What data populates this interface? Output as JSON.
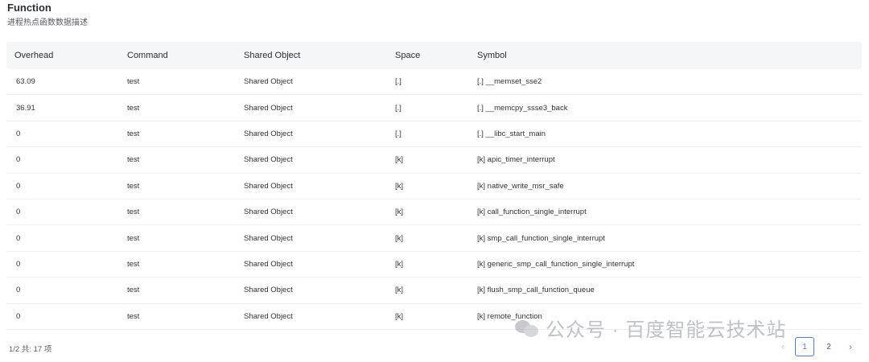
{
  "header": {
    "title": "Function",
    "subtitle": "进程热点函数数据描述"
  },
  "table": {
    "columns": [
      "Overhead",
      "Command",
      "Shared Object",
      "Space",
      "Symbol"
    ],
    "rows": [
      {
        "overhead": "63.09",
        "command": "test",
        "shared_object": "Shared Object",
        "space": "[.]",
        "symbol": "[.] __memset_sse2"
      },
      {
        "overhead": "36.91",
        "command": "test",
        "shared_object": "Shared Object",
        "space": "[.]",
        "symbol": "[.] __memcpy_ssse3_back"
      },
      {
        "overhead": "0",
        "command": "test",
        "shared_object": "Shared Object",
        "space": "[.]",
        "symbol": "[.] __libc_start_main"
      },
      {
        "overhead": "0",
        "command": "test",
        "shared_object": "Shared Object",
        "space": "[k]",
        "symbol": "[k] apic_timer_interrupt"
      },
      {
        "overhead": "0",
        "command": "test",
        "shared_object": "Shared Object",
        "space": "[k]",
        "symbol": "[k] native_write_msr_safe"
      },
      {
        "overhead": "0",
        "command": "test",
        "shared_object": "Shared Object",
        "space": "[k]",
        "symbol": "[k] call_function_single_interrupt"
      },
      {
        "overhead": "0",
        "command": "test",
        "shared_object": "Shared Object",
        "space": "[k]",
        "symbol": "[k] smp_call_function_single_interrupt"
      },
      {
        "overhead": "0",
        "command": "test",
        "shared_object": "Shared Object",
        "space": "[k]",
        "symbol": "[k] generic_smp_call_function_single_interrupt"
      },
      {
        "overhead": "0",
        "command": "test",
        "shared_object": "Shared Object",
        "space": "[k]",
        "symbol": "[k] flush_smp_call_function_queue"
      },
      {
        "overhead": "0",
        "command": "test",
        "shared_object": "Shared Object",
        "space": "[k]",
        "symbol": "[k] remote_function"
      }
    ]
  },
  "footer": {
    "info": "1/2 共: 17 项",
    "pages": [
      "1",
      "2"
    ],
    "current_page": "1",
    "prev_icon": "chevron-left-icon",
    "next_icon": "chevron-right-icon",
    "prev_glyph": "‹",
    "next_glyph": "›"
  },
  "watermark": {
    "text": "公众号 · 百度智能云技术站",
    "logo_icon": "wechat-icon"
  },
  "colors": {
    "accent": "#4a7cf6",
    "header_bg": "#f5f6f8",
    "row_border": "#eceef1"
  }
}
